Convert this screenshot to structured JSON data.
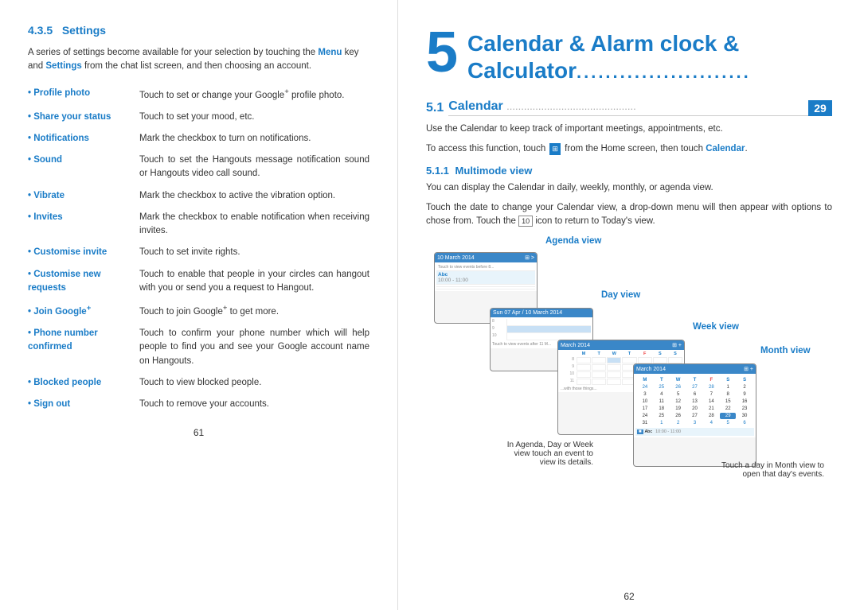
{
  "left": {
    "section": {
      "num": "4.3.5",
      "title": "Settings"
    },
    "intro": "A series of settings become available for your selection by touching the Menu key and Settings from the chat list screen, and then choosing an account.",
    "items": [
      {
        "label": "Profile photo",
        "desc": "Touch to set or change your Google+ profile photo."
      },
      {
        "label": "Share your status",
        "desc": "Touch to set your mood, etc."
      },
      {
        "label": "Notifications",
        "desc": "Mark the checkbox to turn on notifications."
      },
      {
        "label": "Sound",
        "desc": "Touch to set the Hangouts message notification sound or Hangouts video call sound."
      },
      {
        "label": "Vibrate",
        "desc": "Mark the checkbox to active the vibration option."
      },
      {
        "label": "Invites",
        "desc": "Mark the checkbox to enable notification when receiving invites."
      },
      {
        "label": "Customise invite",
        "desc": "Touch to set invite rights."
      },
      {
        "label": "Customise new requests",
        "desc": "Touch to enable that people in your circles can hangout with you or send you a request to Hangout."
      },
      {
        "label": "Join Google+",
        "desc": "Touch to join Google+ to get more."
      },
      {
        "label": "Phone number confirmed",
        "desc": "Touch to confirm your phone number which will help people to find you and see your Google account name on Hangouts."
      },
      {
        "label": "Blocked people",
        "desc": "Touch to view blocked people."
      },
      {
        "label": "Sign out",
        "desc": "Touch to remove your accounts."
      }
    ],
    "page_num": "61"
  },
  "right": {
    "chapter_num": "5",
    "chapter_title": "Calendar & Alarm clock & Calculator",
    "section": {
      "num": "5.1",
      "label": "Calendar",
      "dots": ".............................................",
      "page": "29"
    },
    "body1": "Use the Calendar to keep track of important meetings, appointments, etc.",
    "body2": "To access this function, touch",
    "body2b": "from the Home screen, then touch",
    "body2c": "Calendar.",
    "subsection": {
      "num": "5.1.1",
      "title": "Multimode view"
    },
    "body3": "You can display the Calendar in daily, weekly, monthly, or agenda view.",
    "body4": "Touch the date to change your Calendar view, a drop-down menu will then appear with options to chose from. Touch the",
    "body4b": "10",
    "body4c": "icon to return to Today's view.",
    "views": {
      "agenda": "Agenda view",
      "day": "Day view",
      "week": "Week view",
      "month": "Month view"
    },
    "caption1": "In Agenda, Day or Week view touch an event to view its details.",
    "caption2": "Touch a day in Month view to open that day's events.",
    "page_num": "62"
  }
}
